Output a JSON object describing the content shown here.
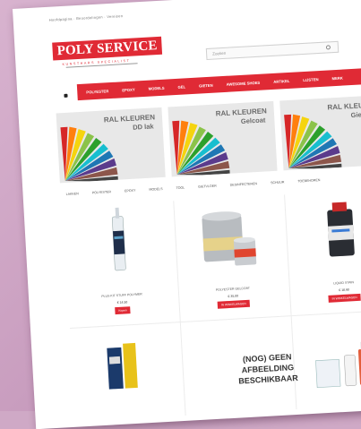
{
  "header": {
    "topline": "Hoofdpagina · Beoordelingen · Vereisen",
    "logo": "POLY SERVICE",
    "tagline": "KUNSTHARS SPECIALIST",
    "search_placeholder": "Zoeken"
  },
  "nav": {
    "items": [
      "POLYESTER",
      "EPOXY",
      "MODELS",
      "GEL",
      "GIETEN",
      "AWESOME SHOES",
      "ARTIKEL",
      "LIJSTEN",
      "MERK"
    ]
  },
  "banners": [
    {
      "title": "RAL KLEUREN",
      "sub": "DD lak"
    },
    {
      "title": "RAL KLEUREN",
      "sub": "Gelcoat"
    },
    {
      "title": "RAL KLEUREN",
      "sub": "Gietvloe"
    }
  ],
  "categories": [
    "LAKKEN",
    "POLYESTER",
    "EPOXY",
    "MODELS",
    "TOOL",
    "GIETVLOER",
    "DESINFECTEREN",
    "SCHUUR",
    "TOEBEHOREN"
  ],
  "products": [
    {
      "name": "PLUS KIT STUFF POLYMER",
      "price": "€ 14,50",
      "button": "Kopen"
    },
    {
      "name": "POLYESTER GELCOAT",
      "price": "€ 35,00",
      "button": "IN WINKELWAGEN"
    },
    {
      "name": "LIQUID STAIN",
      "price": "€ 18,90",
      "button": "IN WINKELWAGEN"
    }
  ],
  "no_image": {
    "line1": "(NOG) GEEN",
    "line2": "AFBEELDING",
    "line3": "BESCHIKBAAR"
  },
  "colors": {
    "brand": "#e02a35"
  }
}
